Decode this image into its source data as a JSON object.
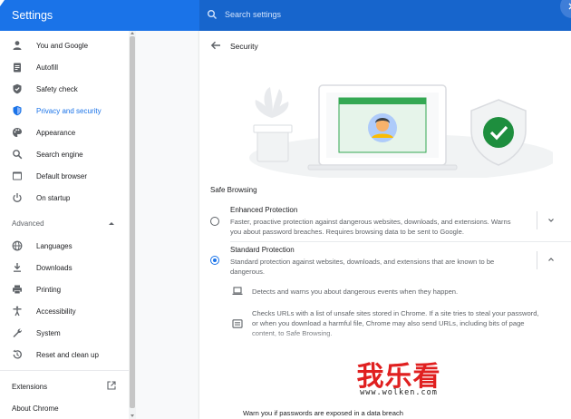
{
  "header": {
    "app_title": "Settings",
    "search_placeholder": "Search settings"
  },
  "sidebar": {
    "items": [
      {
        "label": "You and Google",
        "icon": "person-icon"
      },
      {
        "label": "Autofill",
        "icon": "clipboard-icon"
      },
      {
        "label": "Safety check",
        "icon": "shield-icon"
      },
      {
        "label": "Privacy and security",
        "icon": "shield-lock-icon",
        "active": true
      },
      {
        "label": "Appearance",
        "icon": "palette-icon"
      },
      {
        "label": "Search engine",
        "icon": "search-icon"
      },
      {
        "label": "Default browser",
        "icon": "browser-icon"
      },
      {
        "label": "On startup",
        "icon": "power-icon"
      }
    ],
    "advanced_label": "Advanced",
    "advanced_items": [
      {
        "label": "Languages",
        "icon": "globe-icon"
      },
      {
        "label": "Downloads",
        "icon": "download-icon"
      },
      {
        "label": "Printing",
        "icon": "printer-icon"
      },
      {
        "label": "Accessibility",
        "icon": "accessibility-icon"
      },
      {
        "label": "System",
        "icon": "wrench-icon"
      },
      {
        "label": "Reset and clean up",
        "icon": "history-icon"
      }
    ],
    "extensions_label": "Extensions",
    "about_label": "About Chrome"
  },
  "main": {
    "title": "Security",
    "section_title": "Safe Browsing",
    "options": [
      {
        "title": "Enhanced Protection",
        "description": "Faster, proactive protection against dangerous websites, downloads, and extensions. Warns you about password breaches. Requires browsing data to be sent to Google.",
        "selected": false
      },
      {
        "title": "Standard Protection",
        "description": "Standard protection against websites, downloads, and extensions that are known to be dangerous.",
        "selected": true
      }
    ],
    "sub_items": [
      {
        "text": "Detects and warns you about dangerous events when they happen.",
        "icon": "laptop-icon"
      },
      {
        "text": "Checks URLs with a list of unsafe sites stored in Chrome. If a site tries to steal your password, or when you download a harmful file, Chrome may also send URLs, including bits of page content, to Safe Browsing.",
        "icon": "list-window-icon"
      }
    ],
    "bottom_text": "Warn you if passwords are exposed in a data breach"
  },
  "watermark": {
    "text": "我乐看",
    "url": "www.wolken.com"
  },
  "colors": {
    "accent": "#1a73e8",
    "header": "#1a73e8",
    "watermark": "#e02020",
    "shield_green": "#1e8e3e"
  }
}
